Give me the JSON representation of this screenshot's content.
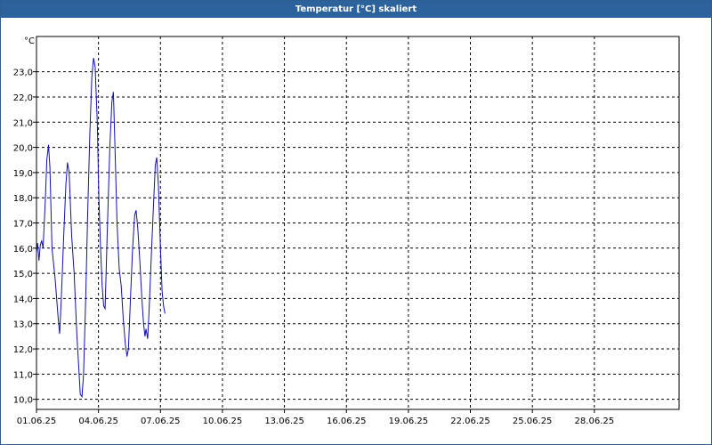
{
  "window": {
    "title": "Temperatur [°C] skaliert"
  },
  "chart_data": {
    "type": "line",
    "ylabel": "°C",
    "ylim": [
      9.6,
      24.4
    ],
    "xlim_day": [
      1,
      32.1
    ],
    "x_tick_labels": [
      "01.06.25",
      "04.06.25",
      "07.06.25",
      "10.06.25",
      "13.06.25",
      "16.06.25",
      "19.06.25",
      "22.06.25",
      "25.06.25",
      "28.06.25"
    ],
    "x_tick_days": [
      1,
      4,
      7,
      10,
      13,
      16,
      19,
      22,
      25,
      28
    ],
    "y_ticks": [
      10.0,
      11.0,
      12.0,
      13.0,
      14.0,
      15.0,
      16.0,
      17.0,
      18.0,
      19.0,
      20.0,
      21.0,
      22.0,
      23.0
    ],
    "y_tick_labels": [
      "10,0",
      "11,0",
      "12,0",
      "13,0",
      "14,0",
      "15,0",
      "16,0",
      "17,0",
      "18,0",
      "19,0",
      "20,0",
      "21,0",
      "22,0",
      "23,0"
    ],
    "grid": true,
    "series": [
      {
        "color": "#1010b0",
        "points": [
          [
            1.0,
            15.8
          ],
          [
            1.05,
            16.2
          ],
          [
            1.12,
            15.5
          ],
          [
            1.18,
            16.1
          ],
          [
            1.25,
            16.3
          ],
          [
            1.32,
            16.0
          ],
          [
            1.42,
            17.8
          ],
          [
            1.5,
            19.5
          ],
          [
            1.58,
            20.1
          ],
          [
            1.65,
            19.2
          ],
          [
            1.75,
            16.0
          ],
          [
            1.9,
            14.8
          ],
          [
            2.05,
            13.2
          ],
          [
            2.12,
            12.6
          ],
          [
            2.2,
            14.0
          ],
          [
            2.32,
            16.5
          ],
          [
            2.42,
            18.5
          ],
          [
            2.5,
            19.4
          ],
          [
            2.58,
            19.0
          ],
          [
            2.7,
            16.5
          ],
          [
            2.82,
            15.0
          ],
          [
            2.95,
            12.6
          ],
          [
            3.05,
            11.2
          ],
          [
            3.12,
            10.2
          ],
          [
            3.2,
            10.1
          ],
          [
            3.28,
            11.0
          ],
          [
            3.38,
            14.0
          ],
          [
            3.48,
            17.5
          ],
          [
            3.58,
            20.5
          ],
          [
            3.68,
            22.8
          ],
          [
            3.76,
            23.55
          ],
          [
            3.84,
            23.2
          ],
          [
            3.94,
            21.0
          ],
          [
            4.02,
            18.0
          ],
          [
            4.1,
            16.0
          ],
          [
            4.18,
            14.5
          ],
          [
            4.25,
            13.7
          ],
          [
            4.32,
            13.6
          ],
          [
            4.42,
            16.5
          ],
          [
            4.55,
            20.0
          ],
          [
            4.65,
            21.8
          ],
          [
            4.72,
            22.2
          ],
          [
            4.8,
            20.0
          ],
          [
            4.9,
            17.0
          ],
          [
            5.0,
            15.2
          ],
          [
            5.1,
            14.5
          ],
          [
            5.2,
            13.2
          ],
          [
            5.3,
            12.2
          ],
          [
            5.38,
            11.7
          ],
          [
            5.45,
            12.0
          ],
          [
            5.55,
            14.0
          ],
          [
            5.65,
            16.0
          ],
          [
            5.75,
            17.3
          ],
          [
            5.82,
            17.5
          ],
          [
            5.9,
            16.8
          ],
          [
            6.0,
            15.5
          ],
          [
            6.1,
            14.0
          ],
          [
            6.18,
            13.0
          ],
          [
            6.25,
            12.5
          ],
          [
            6.3,
            12.8
          ],
          [
            6.38,
            12.4
          ],
          [
            6.45,
            13.5
          ],
          [
            6.55,
            15.5
          ],
          [
            6.65,
            17.5
          ],
          [
            6.75,
            19.3
          ],
          [
            6.82,
            19.6
          ],
          [
            6.9,
            18.5
          ],
          [
            7.0,
            16.0
          ],
          [
            7.08,
            14.3
          ],
          [
            7.15,
            13.7
          ],
          [
            7.22,
            13.4
          ]
        ]
      }
    ]
  }
}
